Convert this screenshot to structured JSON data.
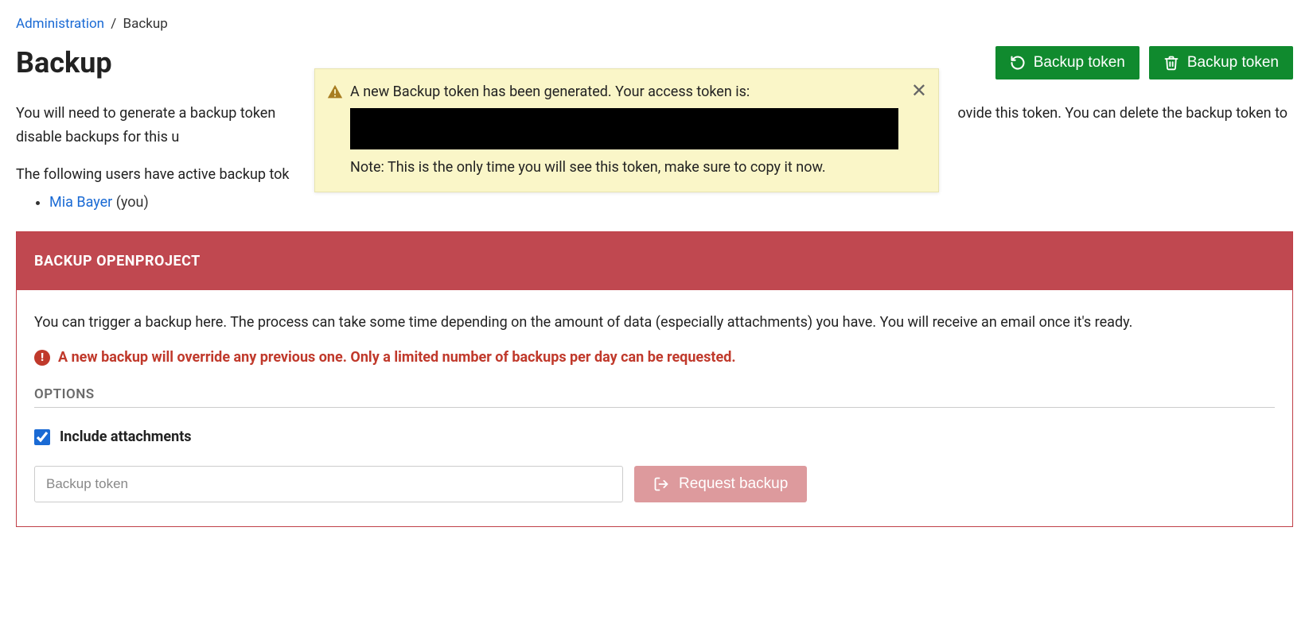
{
  "breadcrumb": {
    "root": "Administration",
    "separator": "/",
    "current": "Backup"
  },
  "page_title": "Backup",
  "actions": {
    "regenerate": "Backup token",
    "delete": "Backup token"
  },
  "toast": {
    "title": "A new Backup token has been generated. Your access token is:",
    "note": "Note: This is the only time you will see this token, make sure to copy it now."
  },
  "intro_prefix": "You will need to generate a backup token ",
  "intro_suffix": "ovide this token. You can delete the backup token to disable backups for this u",
  "users_label_prefix": "The following users have active backup tok",
  "users": [
    {
      "name": "Mia Bayer",
      "suffix": "(you)"
    }
  ],
  "panel": {
    "header": "BACKUP OPENPROJECT",
    "description": "You can trigger a backup here. The process can take some time depending on the amount of data (especially attachments) you have. You will receive an email once it's ready.",
    "warning": "A new backup will override any previous one. Only a limited number of backups per day can be requested.",
    "options_heading": "OPTIONS",
    "include_attachments": "Include attachments",
    "token_placeholder": "Backup token",
    "request_button": "Request backup"
  }
}
